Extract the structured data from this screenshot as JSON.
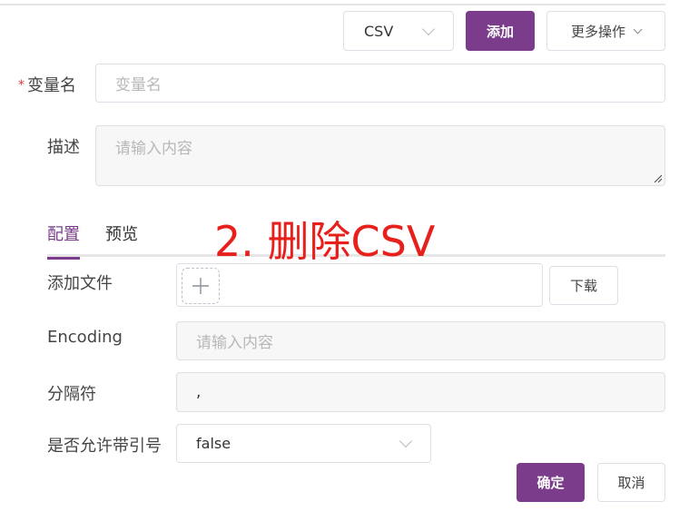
{
  "toolbar": {
    "type_select": "CSV",
    "add_label": "添加",
    "more_label": "更多操作"
  },
  "form": {
    "var_name_label": "变量名",
    "required_mark": "*",
    "var_name_placeholder": "变量名",
    "desc_label": "描述",
    "desc_placeholder": "请输入内容"
  },
  "tabs": [
    {
      "label": "配置",
      "active": true
    },
    {
      "label": "预览",
      "active": false
    }
  ],
  "annotation": "2. 删除CSV",
  "config": {
    "add_file_label": "添加文件",
    "download_label": "下载",
    "encoding_label": "Encoding",
    "encoding_placeholder": "请输入内容",
    "separator_label": "分隔符",
    "separator_value": ",",
    "quote_label": "是否允许带引号",
    "quote_value": "false"
  },
  "footer": {
    "confirm_label": "确定",
    "cancel_label": "取消"
  },
  "colors": {
    "primary": "#7b3d8b",
    "annotation": "#e8201c",
    "border": "#dcdfe6"
  }
}
